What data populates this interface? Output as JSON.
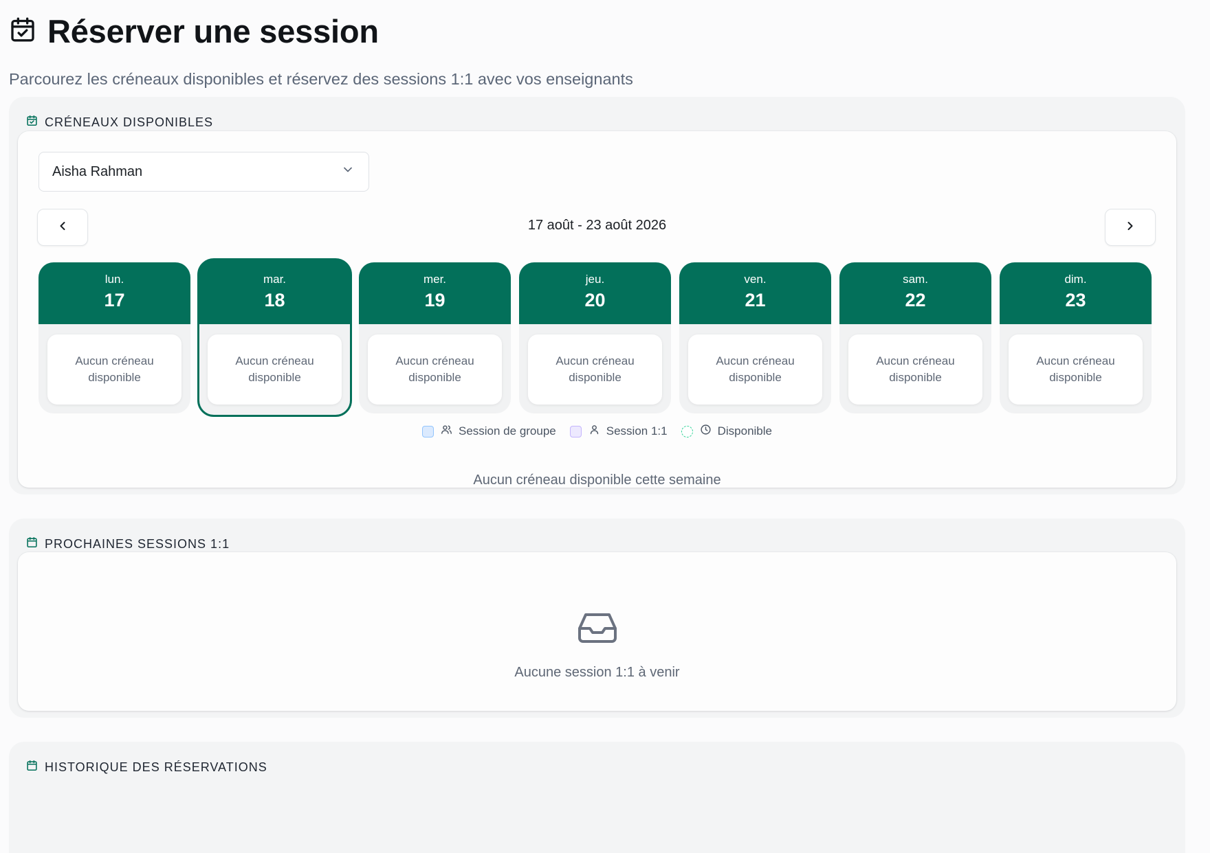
{
  "header": {
    "icon": "calendar-check-icon",
    "title": "Réserver une session",
    "subtitle": "Parcourez les créneaux disponibles et réservez des sessions 1:1 avec vos enseignants"
  },
  "available_slots": {
    "label": "CRÉNEAUX DISPONIBLES",
    "icon": "calendar-check-icon",
    "teacher_select": {
      "value": "Aisha Rahman"
    },
    "week_range": "17 août - 23 août 2026",
    "days": [
      {
        "name": "lun.",
        "num": "17",
        "empty": "Aucun créneau disponible"
      },
      {
        "name": "mar.",
        "num": "18",
        "empty": "Aucun créneau disponible"
      },
      {
        "name": "mer.",
        "num": "19",
        "empty": "Aucun créneau disponible"
      },
      {
        "name": "jeu.",
        "num": "20",
        "empty": "Aucun créneau disponible"
      },
      {
        "name": "ven.",
        "num": "21",
        "empty": "Aucun créneau disponible"
      },
      {
        "name": "sam.",
        "num": "22",
        "empty": "Aucun créneau disponible"
      },
      {
        "name": "dim.",
        "num": "23",
        "empty": "Aucun créneau disponible"
      }
    ],
    "legend": {
      "group": "Session de groupe",
      "one_on_one": "Session 1:1",
      "available": "Disponible"
    },
    "empty_week": "Aucun créneau disponible cette semaine"
  },
  "upcoming": {
    "label": "PROCHAINES SESSIONS 1:1",
    "icon": "calendar-icon",
    "empty_icon": "inbox-icon",
    "empty": "Aucune session 1:1 à venir"
  },
  "history": {
    "label": "HISTORIQUE DES RÉSERVATIONS",
    "icon": "calendar-icon"
  },
  "colors": {
    "accent": "#03705a",
    "page_bg": "#fbfbfc",
    "section_bg": "#f3f4f5"
  }
}
